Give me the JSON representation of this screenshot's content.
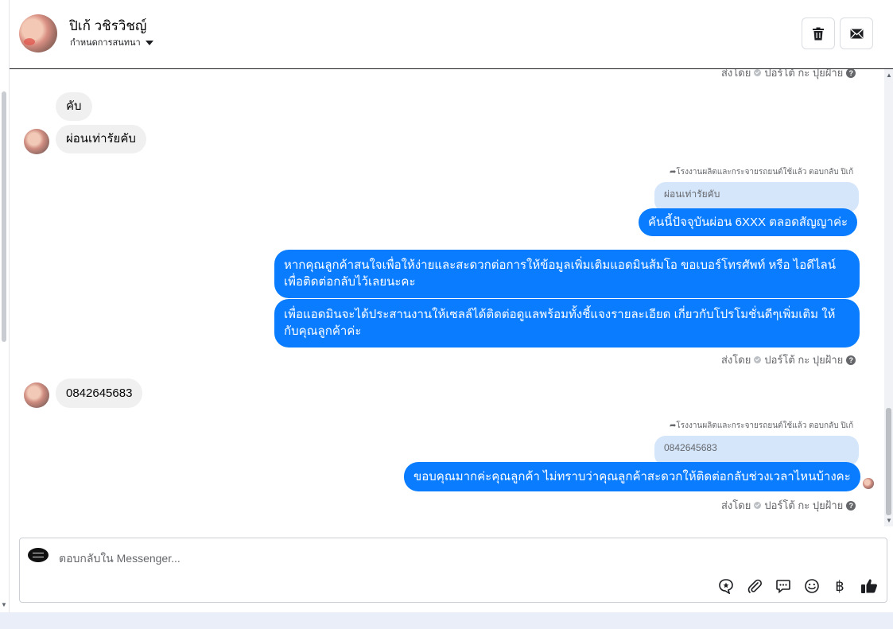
{
  "header": {
    "contact_name": "ปิเก้ วชิรวิชญ์",
    "conversation_label": "กำหนดการสนทนา",
    "delete_icon": "trash-icon",
    "mail_icon": "mail-icon"
  },
  "thread": {
    "top_sent_by": "ส่งโดย",
    "top_sender": "ปอร์โต้ กะ ปุยฝ้าย",
    "incoming_1": "คับ",
    "incoming_2": "ผ่อนเท่ารัยคับ",
    "reply_note_1": "โรงงานผลิตและกระจายรถยนต์ใช้แล้ว ตอบกลับ ปิเก้",
    "reply_quote_1": "ผ่อนเท่ารัยคับ",
    "outgoing_1": "คันนี้ปัจจุบันผ่อน 6XXX ตลอดสัญญาค่ะ",
    "outgoing_2": "หากคุณลูกค้าสนใจเพื่อให้ง่ายและสะดวกต่อการให้ข้อมูลเพิ่มเติมแอดมินส้มโอ ขอเบอร์โทรศัพท์ หรือ ไอดีไลน์ เพื่อติดต่อกลับไว้เลยนะคะ",
    "outgoing_3": "เพื่อแอดมินจะได้ประสานงานให้เซลล์ได้ติดต่อดูแลพร้อมทั้งชี้แจงรายละเอียด เกี่ยวกับโปรโมชั่นดีๆเพิ่มเติม ให้กับคุณลูกค้าค่ะ",
    "sent_by_1": "ส่งโดย",
    "sender_1": "ปอร์โต้ กะ ปุยฝ้าย",
    "incoming_3": "0842645683",
    "reply_note_2": "โรงงานผลิตและกระจายรถยนต์ใช้แล้ว ตอบกลับ ปิเก้",
    "reply_quote_2": "0842645683",
    "outgoing_4": "ขอบคุณมากค่ะคุณลูกค้า ไม่ทราบว่าคุณลูกค้าสะดวกให้ติดต่อกลับช่วงเวลาไหนบ้างคะ",
    "sent_by_2": "ส่งโดย",
    "sender_2": "ปอร์โต้ กะ ปุยฝ้าย"
  },
  "composer": {
    "placeholder": "ตอบกลับใน Messenger...",
    "tools": [
      "saved-reply-icon",
      "attachment-icon",
      "message-icon",
      "emoji-icon",
      "baht-icon",
      "like-icon"
    ]
  },
  "colors": {
    "outgoing_bubble": "#0a7cff",
    "incoming_bubble": "#f0f0f0",
    "reply_quote": "#d5e6fb"
  }
}
